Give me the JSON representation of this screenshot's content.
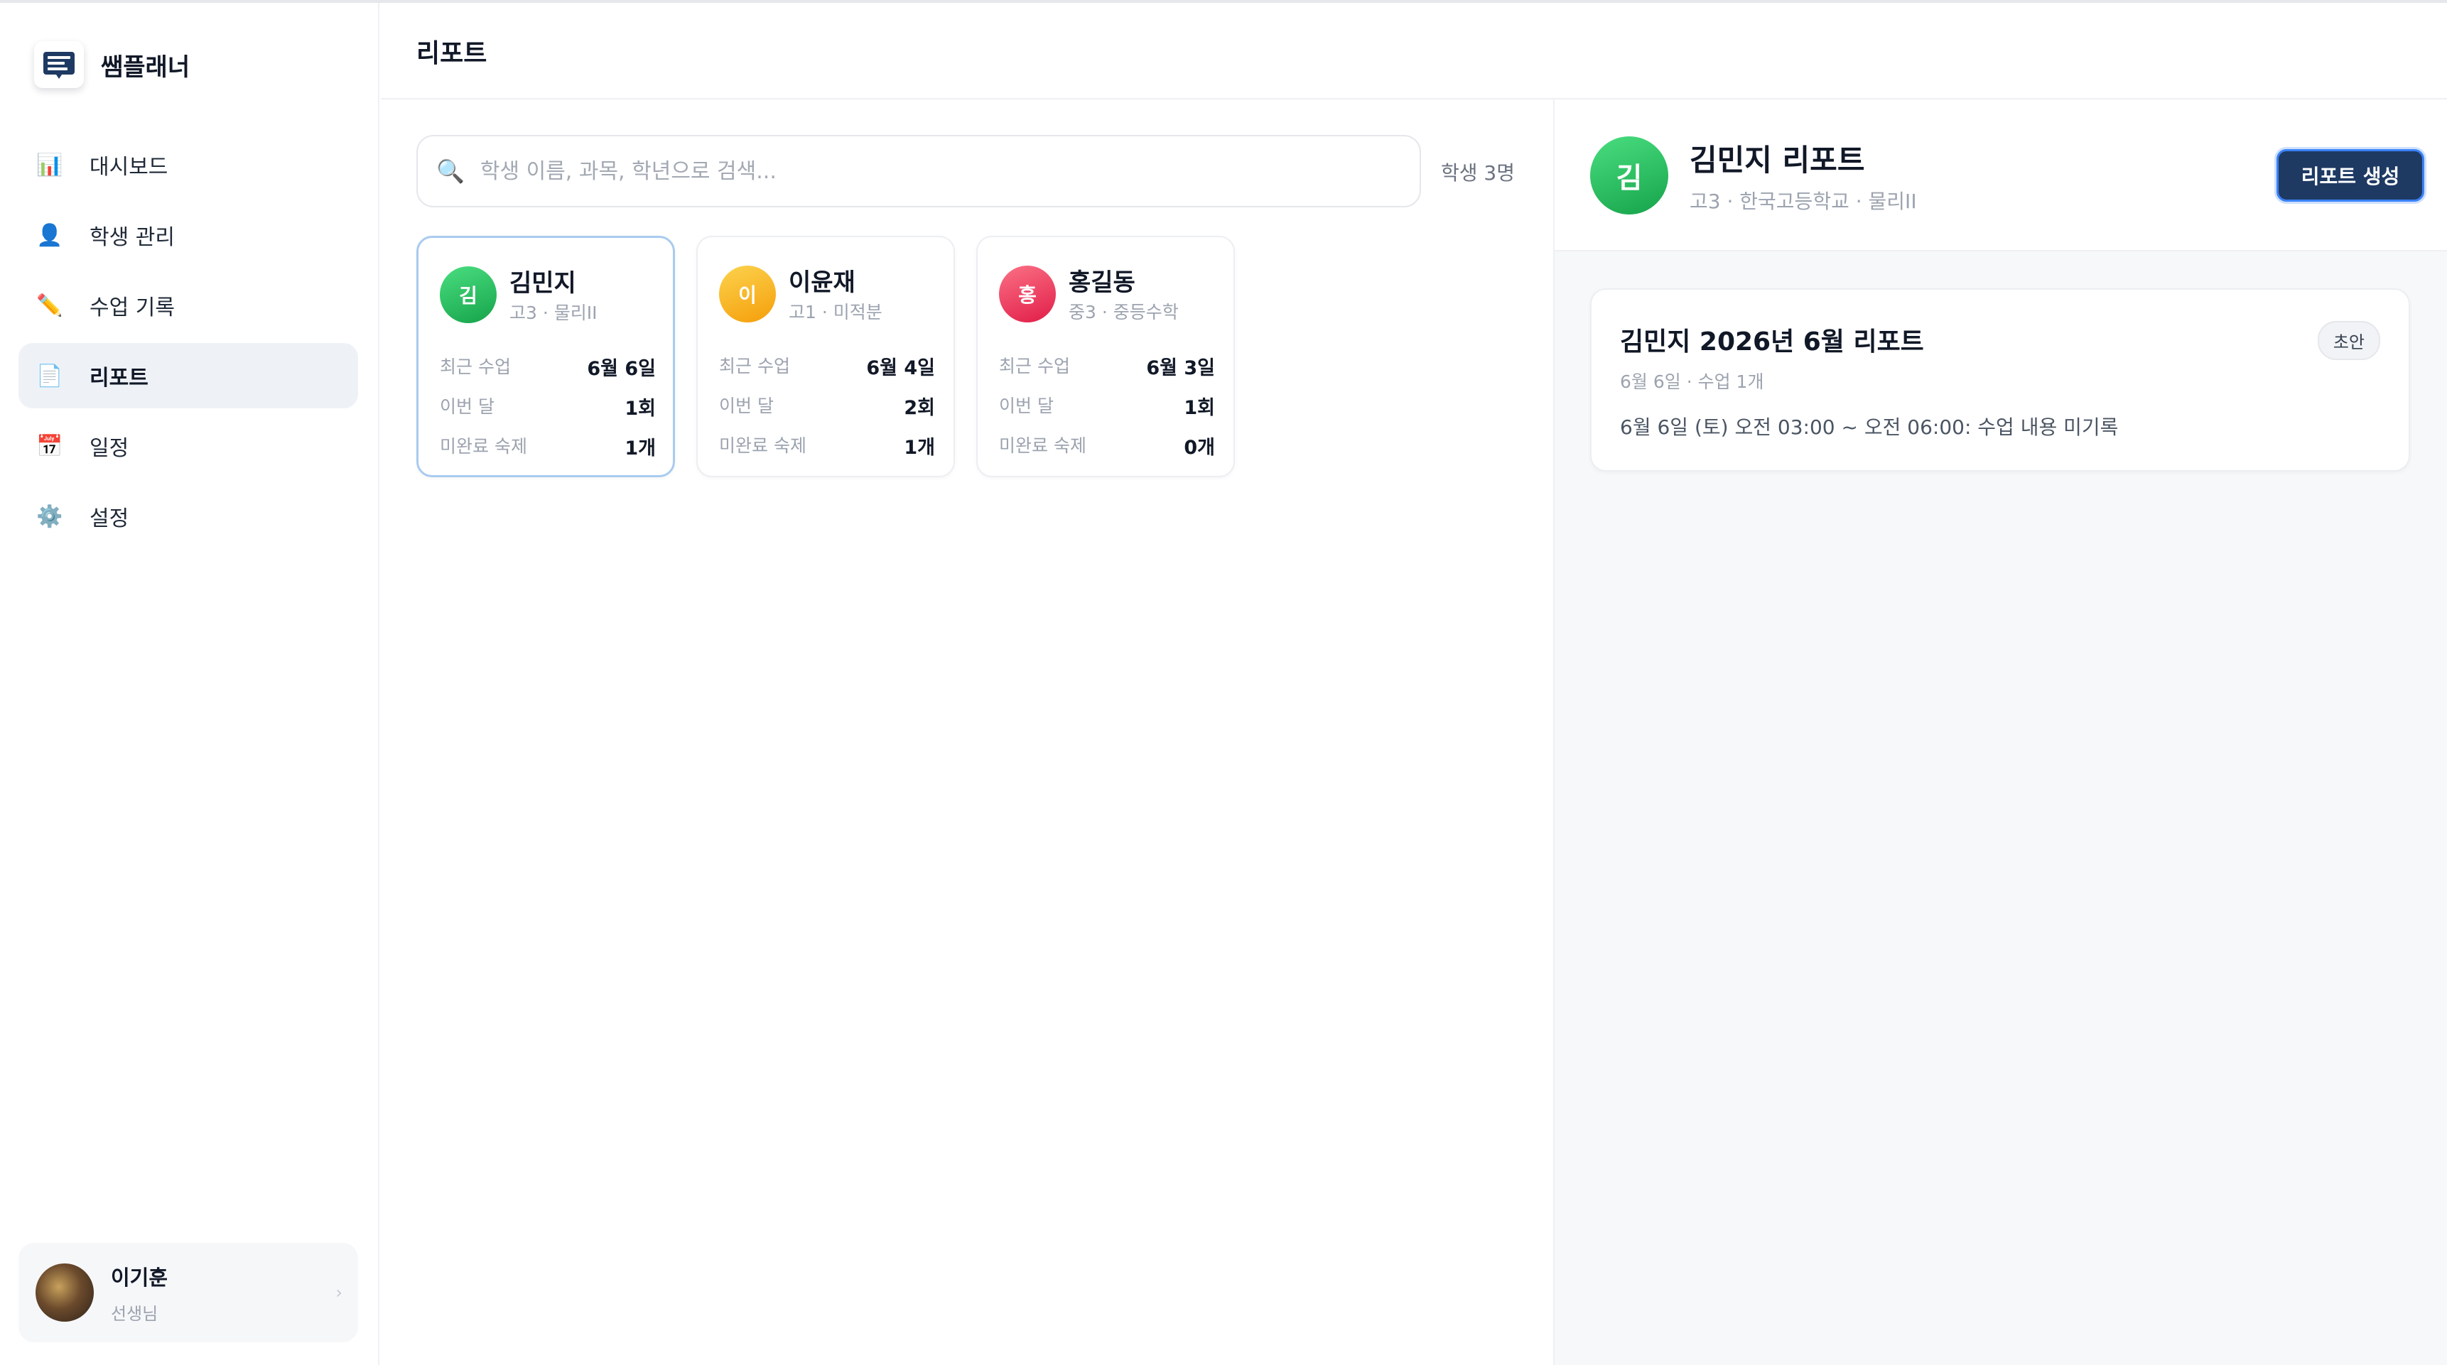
{
  "brand": {
    "name": "쌤플래너"
  },
  "sidebar": {
    "items": [
      {
        "icon": "bar-chart-icon",
        "glyph": "📊",
        "label": "대시보드",
        "active": false
      },
      {
        "icon": "person-icon",
        "glyph": "👤",
        "label": "학생 관리",
        "active": false
      },
      {
        "icon": "pencil-icon",
        "glyph": "✏️",
        "label": "수업 기록",
        "active": false
      },
      {
        "icon": "document-icon",
        "glyph": "📄",
        "label": "리포트",
        "active": true
      },
      {
        "icon": "calendar-icon",
        "glyph": "📅",
        "label": "일정",
        "active": false
      },
      {
        "icon": "gear-icon",
        "glyph": "⚙️",
        "label": "설정",
        "active": false
      }
    ],
    "user": {
      "name": "이기훈",
      "role": "선생님"
    }
  },
  "header": {
    "title": "리포트"
  },
  "search": {
    "placeholder": "학생 이름, 과목, 학년으로 검색...",
    "value": ""
  },
  "student_count": "학생 3명",
  "students": [
    {
      "initial": "김",
      "name": "김민지",
      "sub": "고3 · 물리II",
      "color_from": "#4ade80",
      "color_to": "#16a34a",
      "selected": true,
      "rows": [
        {
          "label": "최근 수업",
          "value": "6월 6일"
        },
        {
          "label": "이번 달",
          "value": "1회"
        },
        {
          "label": "미완료 숙제",
          "value": "1개"
        }
      ]
    },
    {
      "initial": "이",
      "name": "이윤재",
      "sub": "고1 · 미적분",
      "color_from": "#fcd34d",
      "color_to": "#f59e0b",
      "selected": false,
      "rows": [
        {
          "label": "최근 수업",
          "value": "6월 4일"
        },
        {
          "label": "이번 달",
          "value": "2회"
        },
        {
          "label": "미완료 숙제",
          "value": "1개"
        }
      ]
    },
    {
      "initial": "홍",
      "name": "홍길동",
      "sub": "중3 · 중등수학",
      "color_from": "#fb7185",
      "color_to": "#e11d48",
      "selected": false,
      "rows": [
        {
          "label": "최근 수업",
          "value": "6월 3일"
        },
        {
          "label": "이번 달",
          "value": "1회"
        },
        {
          "label": "미완료 숙제",
          "value": "0개"
        }
      ]
    }
  ],
  "detail": {
    "avatar_initial": "김",
    "title": "김민지 리포트",
    "sub": "고3 · 한국고등학교 · 물리II",
    "generate_label": "리포트 생성",
    "report": {
      "title": "김민지 2026년 6월 리포트",
      "badge": "초안",
      "meta": "6월 6일 · 수업 1개",
      "body": "6월 6일 (토) 오전 03:00 ~ 오전 06:00: 수업 내용 미기록"
    }
  }
}
